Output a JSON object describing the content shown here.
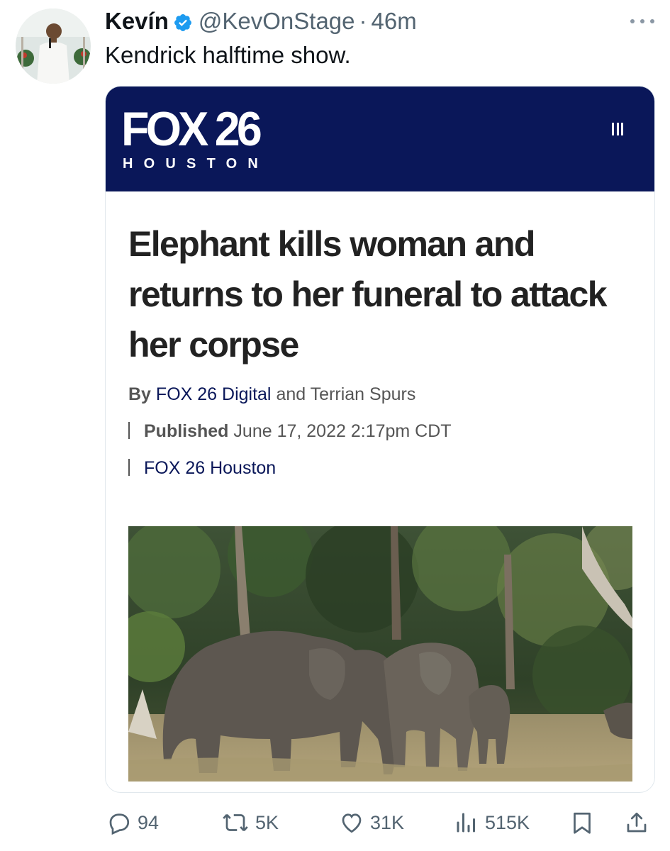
{
  "tweet": {
    "author": {
      "display_name": "Kevín",
      "handle": "@KevOnStage",
      "separator": "·",
      "time": "46m",
      "verified_icon": "verified-badge-icon"
    },
    "more_icon": "more-horizontal-icon",
    "text": "Kendrick halftime show."
  },
  "article_card": {
    "site_logo": {
      "brand": "FOX 26",
      "city": "HOUSTON"
    },
    "menu_icon": "hamburger-menu-icon",
    "headline": "Elephant kills woman and returns to her funeral to attack her corpse",
    "byline": {
      "by_label": "By",
      "author_1": "FOX 26 Digital",
      "conjunction": "and",
      "author_2": "Terrian Spurs"
    },
    "published": {
      "label": "Published",
      "date": "June 17, 2022 2:17pm CDT"
    },
    "source": "FOX 26 Houston",
    "image_subject": "elephants-in-forest"
  },
  "actions": {
    "reply": {
      "icon": "reply-icon",
      "count": "94"
    },
    "retweet": {
      "icon": "retweet-icon",
      "count": "5K"
    },
    "like": {
      "icon": "heart-icon",
      "count": "31K"
    },
    "views": {
      "icon": "views-chart-icon",
      "count": "515K"
    },
    "bookmark": {
      "icon": "bookmark-icon"
    },
    "share": {
      "icon": "share-icon"
    }
  },
  "colors": {
    "fox_navy": "#0a1759",
    "verified_blue": "#1d9bf0",
    "secondary_text": "#536471"
  }
}
